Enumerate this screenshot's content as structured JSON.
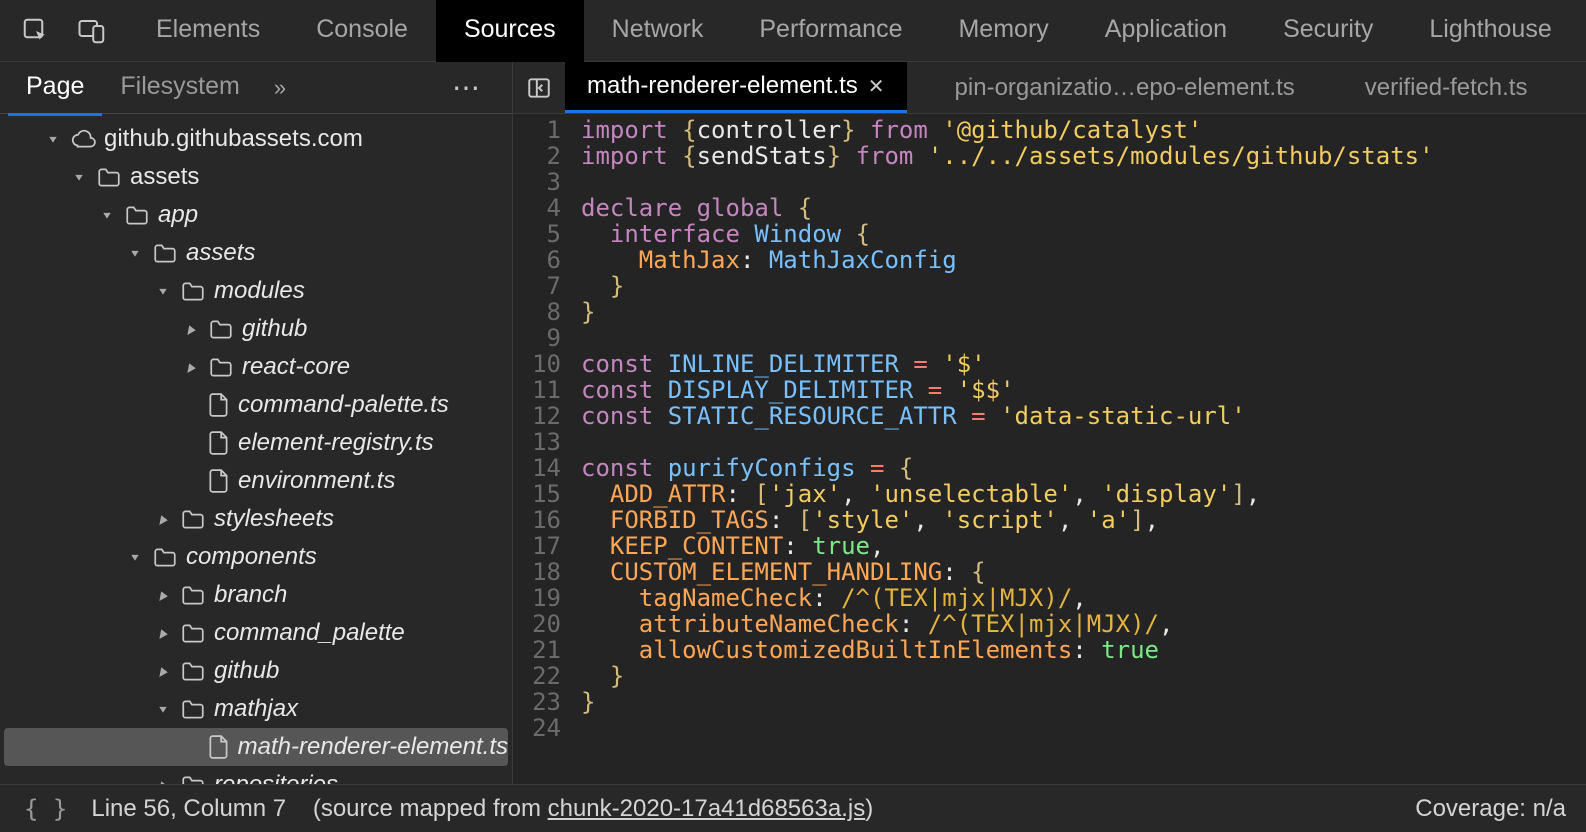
{
  "toolbar": {
    "tabs": [
      "Elements",
      "Console",
      "Sources",
      "Network",
      "Performance",
      "Memory",
      "Application",
      "Security",
      "Lighthouse"
    ],
    "active": 2
  },
  "sidebar": {
    "tabs": [
      "Page",
      "Filesystem"
    ],
    "active": 0,
    "tree": [
      {
        "depth": 0,
        "arrow": "expanded",
        "icon": "cloud",
        "label": "github.githubassets.com",
        "italic": false
      },
      {
        "depth": 1,
        "arrow": "expanded",
        "icon": "folder",
        "label": "assets",
        "italic": false
      },
      {
        "depth": 2,
        "arrow": "expanded",
        "icon": "folder",
        "label": "app",
        "italic": true
      },
      {
        "depth": 3,
        "arrow": "expanded",
        "icon": "folder",
        "label": "assets",
        "italic": true
      },
      {
        "depth": 4,
        "arrow": "expanded",
        "icon": "folder",
        "label": "modules",
        "italic": true
      },
      {
        "depth": 5,
        "arrow": "collapsed",
        "icon": "folder",
        "label": "github",
        "italic": true
      },
      {
        "depth": 5,
        "arrow": "collapsed",
        "icon": "folder",
        "label": "react-core",
        "italic": true
      },
      {
        "depth": 5,
        "arrow": "",
        "icon": "file",
        "label": "command-palette.ts",
        "italic": true
      },
      {
        "depth": 5,
        "arrow": "",
        "icon": "file",
        "label": "element-registry.ts",
        "italic": true
      },
      {
        "depth": 5,
        "arrow": "",
        "icon": "file",
        "label": "environment.ts",
        "italic": true
      },
      {
        "depth": 4,
        "arrow": "collapsed",
        "icon": "folder",
        "label": "stylesheets",
        "italic": true
      },
      {
        "depth": 3,
        "arrow": "expanded",
        "icon": "folder",
        "label": "components",
        "italic": true
      },
      {
        "depth": 4,
        "arrow": "collapsed",
        "icon": "folder",
        "label": "branch",
        "italic": true
      },
      {
        "depth": 4,
        "arrow": "collapsed",
        "icon": "folder",
        "label": "command_palette",
        "italic": true
      },
      {
        "depth": 4,
        "arrow": "collapsed",
        "icon": "folder",
        "label": "github",
        "italic": true
      },
      {
        "depth": 4,
        "arrow": "expanded",
        "icon": "folder",
        "label": "mathjax",
        "italic": true
      },
      {
        "depth": 5,
        "arrow": "",
        "icon": "file",
        "label": "math-renderer-element.ts",
        "italic": true,
        "selected": true
      },
      {
        "depth": 4,
        "arrow": "collapsed",
        "icon": "folder",
        "label": "repositories",
        "italic": true
      }
    ]
  },
  "editor": {
    "tabs": [
      {
        "label": "math-renderer-element.ts",
        "closeable": true,
        "active": true
      },
      {
        "label": "pin-organizatio…epo-element.ts",
        "closeable": false,
        "active": false
      },
      {
        "label": "verified-fetch.ts",
        "closeable": false,
        "active": false
      }
    ],
    "code": {
      "start": 1,
      "lines": [
        [
          [
            "kw-import",
            "import"
          ],
          [
            "",
            " "
          ],
          [
            "punct",
            "{"
          ],
          [
            "prop",
            "controller"
          ],
          [
            "punct",
            "}"
          ],
          [
            "",
            " "
          ],
          [
            "kw-from",
            "from"
          ],
          [
            "",
            " "
          ],
          [
            "str",
            "'@github/catalyst'"
          ]
        ],
        [
          [
            "kw-import",
            "import"
          ],
          [
            "",
            " "
          ],
          [
            "punct",
            "{"
          ],
          [
            "prop",
            "sendStats"
          ],
          [
            "punct",
            "}"
          ],
          [
            "",
            " "
          ],
          [
            "kw-from",
            "from"
          ],
          [
            "",
            " "
          ],
          [
            "str",
            "'../../assets/modules/github/stats'"
          ]
        ],
        [],
        [
          [
            "kw-const",
            "declare"
          ],
          [
            "",
            " "
          ],
          [
            "kw-const",
            "global"
          ],
          [
            "",
            " "
          ],
          [
            "punct",
            "{"
          ]
        ],
        [
          [
            "",
            "  "
          ],
          [
            "kw-interface",
            "interface"
          ],
          [
            "",
            " "
          ],
          [
            "ident",
            "Window"
          ],
          [
            "",
            " "
          ],
          [
            "punct",
            "{"
          ]
        ],
        [
          [
            "",
            "    "
          ],
          [
            "orange",
            "MathJax"
          ],
          [
            "prop",
            ": "
          ],
          [
            "ident",
            "MathJaxConfig"
          ]
        ],
        [
          [
            "",
            "  "
          ],
          [
            "punct",
            "}"
          ]
        ],
        [
          [
            "punct",
            "}"
          ]
        ],
        [],
        [
          [
            "kw-const",
            "const"
          ],
          [
            "",
            " "
          ],
          [
            "blue",
            "INLINE_DELIMITER"
          ],
          [
            "",
            " "
          ],
          [
            "red",
            "="
          ],
          [
            "",
            " "
          ],
          [
            "str",
            "'$'"
          ]
        ],
        [
          [
            "kw-const",
            "const"
          ],
          [
            "",
            " "
          ],
          [
            "blue",
            "DISPLAY_DELIMITER"
          ],
          [
            "",
            " "
          ],
          [
            "red",
            "="
          ],
          [
            "",
            " "
          ],
          [
            "str",
            "'$$'"
          ]
        ],
        [
          [
            "kw-const",
            "const"
          ],
          [
            "",
            " "
          ],
          [
            "blue",
            "STATIC_RESOURCE_ATTR"
          ],
          [
            "",
            " "
          ],
          [
            "red",
            "="
          ],
          [
            "",
            " "
          ],
          [
            "str",
            "'data-static-url'"
          ]
        ],
        [],
        [
          [
            "kw-const",
            "const"
          ],
          [
            "",
            " "
          ],
          [
            "blue",
            "purifyConfigs"
          ],
          [
            "",
            " "
          ],
          [
            "red",
            "="
          ],
          [
            "",
            " "
          ],
          [
            "punct",
            "{"
          ]
        ],
        [
          [
            "",
            "  "
          ],
          [
            "orange",
            "ADD_ATTR"
          ],
          [
            "prop",
            ": "
          ],
          [
            "punct",
            "["
          ],
          [
            "str",
            "'jax'"
          ],
          [
            "prop",
            ", "
          ],
          [
            "str",
            "'unselectable'"
          ],
          [
            "prop",
            ", "
          ],
          [
            "str",
            "'display'"
          ],
          [
            "punct",
            "]"
          ],
          [
            "prop",
            ","
          ]
        ],
        [
          [
            "",
            "  "
          ],
          [
            "orange",
            "FORBID_TAGS"
          ],
          [
            "prop",
            ": "
          ],
          [
            "punct",
            "["
          ],
          [
            "str",
            "'style'"
          ],
          [
            "prop",
            ", "
          ],
          [
            "str",
            "'script'"
          ],
          [
            "prop",
            ", "
          ],
          [
            "str",
            "'a'"
          ],
          [
            "punct",
            "]"
          ],
          [
            "prop",
            ","
          ]
        ],
        [
          [
            "",
            "  "
          ],
          [
            "orange",
            "KEEP_CONTENT"
          ],
          [
            "prop",
            ": "
          ],
          [
            "kw-true",
            "true"
          ],
          [
            "prop",
            ","
          ]
        ],
        [
          [
            "",
            "  "
          ],
          [
            "orange",
            "CUSTOM_ELEMENT_HANDLING"
          ],
          [
            "prop",
            ": "
          ],
          [
            "punct",
            "{"
          ]
        ],
        [
          [
            "",
            "    "
          ],
          [
            "orange",
            "tagNameCheck"
          ],
          [
            "prop",
            ": "
          ],
          [
            "regex",
            "/^(TEX|mjx|MJX)/"
          ],
          [
            "prop",
            ","
          ]
        ],
        [
          [
            "",
            "    "
          ],
          [
            "orange",
            "attributeNameCheck"
          ],
          [
            "prop",
            ": "
          ],
          [
            "regex",
            "/^(TEX|mjx|MJX)/"
          ],
          [
            "prop",
            ","
          ]
        ],
        [
          [
            "",
            "    "
          ],
          [
            "orange",
            "allowCustomizedBuiltInElements"
          ],
          [
            "prop",
            ": "
          ],
          [
            "kw-true",
            "true"
          ]
        ],
        [
          [
            "",
            "  "
          ],
          [
            "punct",
            "}"
          ]
        ],
        [
          [
            "punct",
            "}"
          ]
        ],
        []
      ]
    }
  },
  "footer": {
    "pos": "Line 56, Column 7",
    "mapped": "(source mapped from ",
    "mappedFile": "chunk-2020-17a41d68563a.js",
    "mappedClose": ")",
    "coverage": "Coverage: n/a"
  }
}
